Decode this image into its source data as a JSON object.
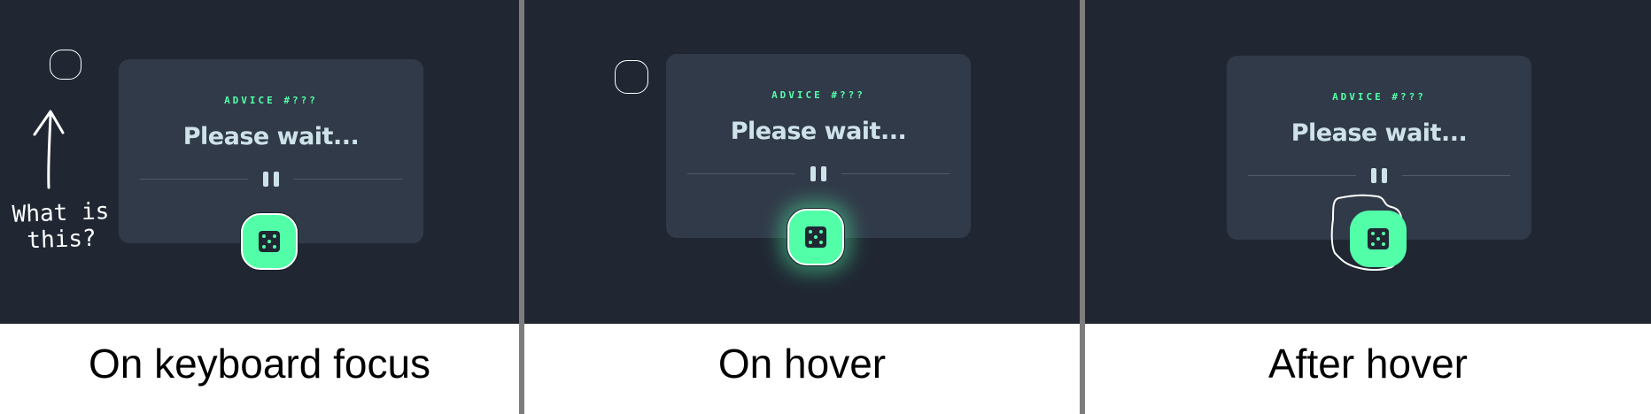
{
  "panels": [
    {
      "caption": "On keyboard focus",
      "card": {
        "label": "ADVICE #???",
        "text": "Please wait..."
      },
      "button": {
        "icon": "dice-icon",
        "state": "focus"
      },
      "annotation": "What is this?"
    },
    {
      "caption": "On hover",
      "card": {
        "label": "ADVICE #???",
        "text": "Please wait..."
      },
      "button": {
        "icon": "dice-icon",
        "state": "hover"
      }
    },
    {
      "caption": "After hover",
      "card": {
        "label": "ADVICE #???",
        "text": "Please wait..."
      },
      "button": {
        "icon": "dice-icon",
        "state": "after-hover"
      }
    }
  ],
  "colors": {
    "background": "#202733",
    "card": "#313a49",
    "accent": "#52ffa8",
    "advice_text": "#cee3e9",
    "divider": "#7d7d7d",
    "caption_bg": "#ffffff"
  }
}
